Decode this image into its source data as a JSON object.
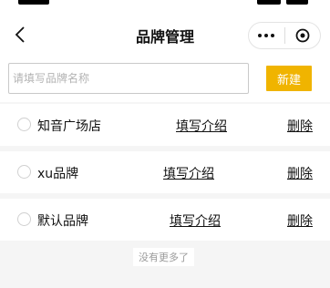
{
  "nav": {
    "title": "品牌管理",
    "back_icon": "chevron-left-icon",
    "more_icon": "ellipsis-icon",
    "close_icon": "target-circle-icon"
  },
  "toolbar": {
    "search_placeholder": "请填写品牌名称",
    "search_value": "",
    "new_label": "新建",
    "new_color": "#f0b400"
  },
  "brands": [
    {
      "name": "知音广场店",
      "intro_label": "填写介绍",
      "delete_label": "删除"
    },
    {
      "name": "xu品牌",
      "intro_label": "填写介绍",
      "delete_label": "删除"
    },
    {
      "name": "默认品牌",
      "intro_label": "填写介绍",
      "delete_label": "删除"
    }
  ],
  "footer": {
    "no_more": "没有更多了"
  },
  "colors": {
    "background": "#f5f5f5",
    "accent": "#f0b400"
  }
}
